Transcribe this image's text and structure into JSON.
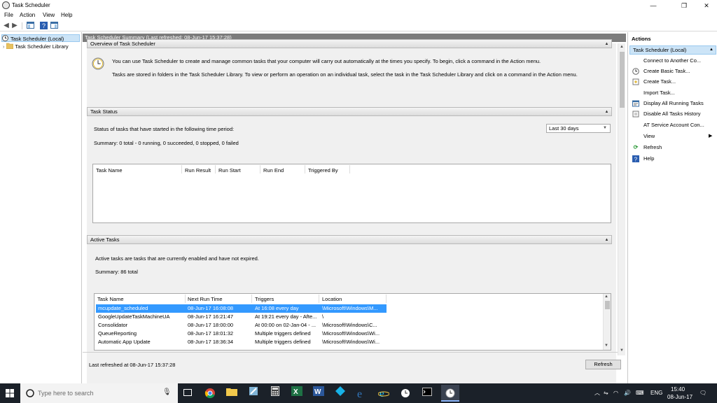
{
  "window": {
    "title": "Task Scheduler",
    "controls": {
      "minimize": "—",
      "maximize": "❐",
      "close": "✕"
    }
  },
  "menu": [
    "File",
    "Action",
    "View",
    "Help"
  ],
  "tree": {
    "items": [
      {
        "label": "Task Scheduler (Local)",
        "selected": true
      },
      {
        "label": "Task Scheduler Library",
        "selected": false
      }
    ]
  },
  "summary_header": "Task Scheduler Summary (Last refreshed: 08-Jun-17 15:37:28)",
  "overview": {
    "title": "Overview of Task Scheduler",
    "line1": "You can use Task Scheduler to create and manage common tasks that your computer will carry out automatically at the times you specify. To begin, click a command in the Action menu.",
    "line2": "Tasks are stored in folders in the Task Scheduler Library. To view or perform an operation on an individual task, select the task in the Task Scheduler Library and click on a command in the Action menu."
  },
  "task_status": {
    "title": "Task Status",
    "period_label": "Status of tasks that have started in the following time period:",
    "period_value": "Last 30 days",
    "summary": "Summary: 0 total - 0 running, 0 succeeded, 0 stopped, 0 failed",
    "columns": [
      "Task Name",
      "Run Result",
      "Run Start",
      "Run End",
      "Triggered By"
    ]
  },
  "active_tasks": {
    "title": "Active Tasks",
    "description": "Active tasks are tasks that are currently enabled and have not expired.",
    "summary": "Summary: 86 total",
    "columns": [
      "Task Name",
      "Next Run Time",
      "Triggers",
      "Location"
    ],
    "rows": [
      {
        "name": "mcupdate_scheduled",
        "next": "08-Jun-17 16:08:08",
        "trigger": "At 16:08 every day",
        "location": "\\Microsoft\\Windows\\M...",
        "selected": true
      },
      {
        "name": "GoogleUpdateTaskMachineUA",
        "next": "08-Jun-17 16:21:47",
        "trigger": "At 19:21 every day - Afte...",
        "location": "\\",
        "selected": false
      },
      {
        "name": "Consolidator",
        "next": "08-Jun-17 18:00:00",
        "trigger": "At 00:00 on 02-Jan-04 - ...",
        "location": "\\Microsoft\\Windows\\C...",
        "selected": false
      },
      {
        "name": "QueueReporting",
        "next": "08-Jun-17 18:01:32",
        "trigger": "Multiple triggers defined",
        "location": "\\Microsoft\\Windows\\Wi...",
        "selected": false
      },
      {
        "name": "Automatic App Update",
        "next": "08-Jun-17 18:36:34",
        "trigger": "Multiple triggers defined",
        "location": "\\Microsoft\\Windows\\Wi...",
        "selected": false
      }
    ]
  },
  "footer": {
    "last_refreshed": "Last refreshed at 08-Jun-17 15:37:28",
    "refresh_button": "Refresh"
  },
  "actions": {
    "title": "Actions",
    "subtitle": "Task Scheduler (Local)",
    "items": [
      {
        "label": "Connect to Another Co...",
        "icon": "computer-icon"
      },
      {
        "label": "Create Basic Task...",
        "icon": "clock-icon"
      },
      {
        "label": "Create Task...",
        "icon": "create-task-icon"
      },
      {
        "label": "Import Task...",
        "icon": ""
      },
      {
        "label": "Display All Running Tasks",
        "icon": "running-tasks-icon"
      },
      {
        "label": "Disable All Tasks History",
        "icon": "history-icon"
      },
      {
        "label": "AT Service Account Con...",
        "icon": ""
      },
      {
        "label": "View",
        "icon": "",
        "submenu": true
      },
      {
        "label": "Refresh",
        "icon": "refresh-icon"
      },
      {
        "label": "Help",
        "icon": "help-icon"
      }
    ]
  },
  "taskbar": {
    "search_placeholder": "Type here to search",
    "language": "ENG",
    "time": "15:40",
    "date": "08-Jun-17"
  },
  "colors": {
    "selection": "#3399ff",
    "tree_selection": "#cce4f7",
    "header_gray": "#7c7c7c",
    "taskbar": "#1b2129"
  }
}
